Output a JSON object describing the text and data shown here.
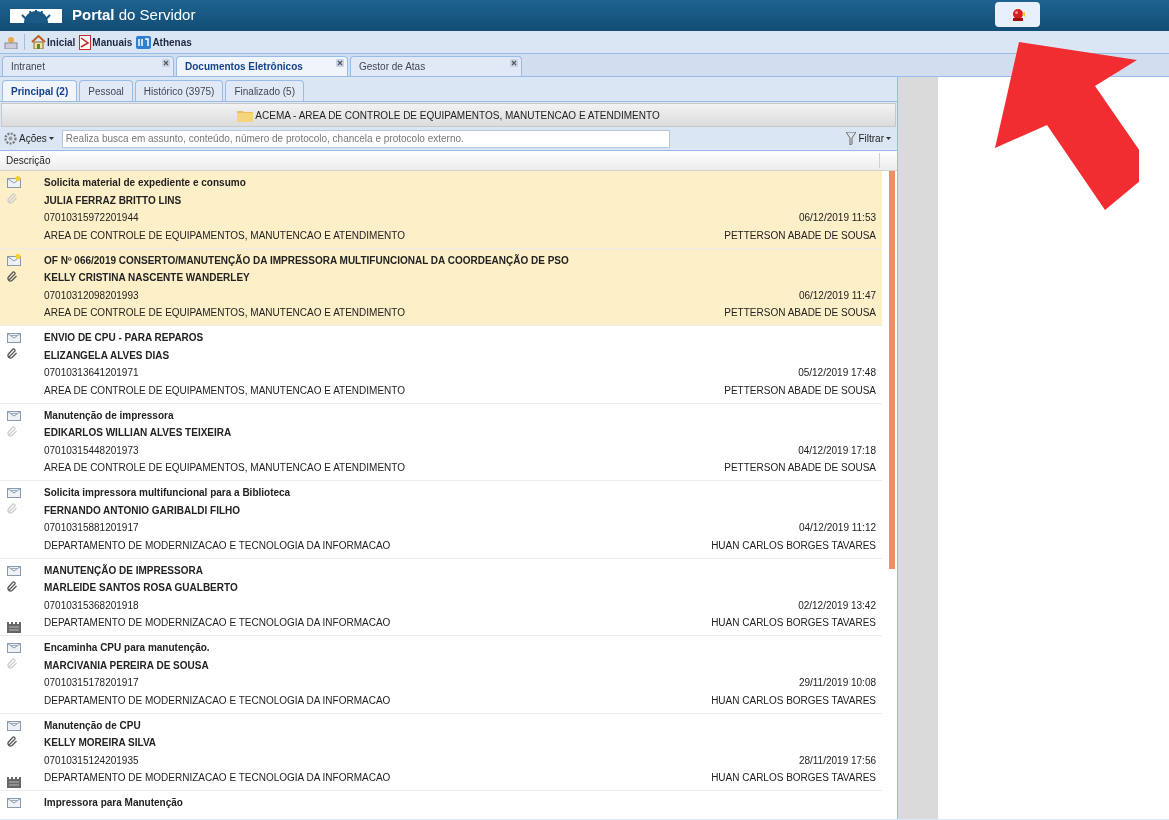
{
  "header": {
    "title": "**Portal** do Servidor"
  },
  "toolbar": [
    {
      "kind": "user"
    },
    {
      "kind": "home",
      "label": "Inicial"
    },
    {
      "kind": "pdf",
      "label": "Manuais"
    },
    {
      "kind": "app",
      "label": "Athenas"
    }
  ],
  "tabs": [
    {
      "label": "Intranet",
      "selected": false
    },
    {
      "label": "Documentos Eletrônicos",
      "selected": true
    },
    {
      "label": "Gestor de Atas",
      "selected": false
    }
  ],
  "subtabs": [
    {
      "label": "Principal (2)",
      "selected": true
    },
    {
      "label": "Pessoal",
      "selected": false
    },
    {
      "label": "Histórico (3975)",
      "selected": false
    },
    {
      "label": "Finalizado (5)",
      "selected": false
    }
  ],
  "folder": "ACEMA - AREA DE CONTROLE DE EQUIPAMENTOS, MANUTENCAO E ATENDIMENTO",
  "actions": "Ações",
  "search": {
    "placeholder": "Realiza busca em assunto, conteúdo, número de protocolo, chancela e protocolo externo."
  },
  "filter": "Filtrar",
  "column": "Descrição",
  "documents": [
    {
      "subject": "Solicita material de expediente e consumo",
      "sender": "JULIA FERRAZ BRITTO LINS",
      "protocol": "07010315972201944",
      "unit": "AREA DE CONTROLE DE EQUIPAMENTOS, MANUTENCAO E ATENDIMENTO",
      "date": "06/12/2019 11:53",
      "recipient": "PETTERSON ABADE DE SOUSA",
      "unread": true,
      "attachment": false,
      "external": false
    },
    {
      "subject": "OF Nº 066/2019 CONSERTO/MANUTENÇÃO DA IMPRESSORA MULTIFUNCIONAL DA COORDEANÇÃO DE PSO",
      "sender": "KELLY CRISTINA NASCENTE WANDERLEY",
      "protocol": "07010312098201993",
      "unit": "AREA DE CONTROLE DE EQUIPAMENTOS, MANUTENCAO E ATENDIMENTO",
      "date": "06/12/2019 11:47",
      "recipient": "PETTERSON ABADE DE SOUSA",
      "unread": true,
      "attachment": true,
      "external": false
    },
    {
      "subject": "ENVIO DE CPU - PARA REPAROS",
      "sender": "ELIZANGELA ALVES DIAS",
      "protocol": "07010313641201971",
      "unit": "AREA DE CONTROLE DE EQUIPAMENTOS, MANUTENCAO E ATENDIMENTO",
      "date": "05/12/2019 17:48",
      "recipient": "PETTERSON ABADE DE SOUSA",
      "unread": false,
      "attachment": true,
      "external": false
    },
    {
      "subject": "Manutenção de impressora",
      "sender": "EDIKARLOS WILLIAN ALVES TEIXEIRA",
      "protocol": "07010315448201973",
      "unit": "AREA DE CONTROLE DE EQUIPAMENTOS, MANUTENCAO E ATENDIMENTO",
      "date": "04/12/2019 17:18",
      "recipient": "PETTERSON ABADE DE SOUSA",
      "unread": false,
      "attachment": false,
      "external": false
    },
    {
      "subject": "Solicita impressora multifuncional para a Biblioteca",
      "sender": "FERNANDO ANTONIO GARIBALDI FILHO",
      "protocol": "07010315881201917",
      "unit": "DEPARTAMENTO DE MODERNIZACAO E TECNOLOGIA DA INFORMACAO",
      "date": "04/12/2019 11:12",
      "recipient": "HUAN CARLOS BORGES TAVARES",
      "unread": false,
      "attachment": false,
      "external": false
    },
    {
      "subject": "MANUTENÇÃO DE IMPRESSORA",
      "sender": "MARLEIDE SANTOS ROSA GUALBERTO",
      "protocol": "07010315368201918",
      "unit": "DEPARTAMENTO DE MODERNIZACAO E TECNOLOGIA DA INFORMACAO",
      "date": "02/12/2019 13:42",
      "recipient": "HUAN CARLOS BORGES TAVARES",
      "unread": false,
      "attachment": true,
      "external": true
    },
    {
      "subject": "Encaminha CPU para manutenção.",
      "sender": "MARCIVANIA PEREIRA DE SOUSA",
      "protocol": "07010315178201917",
      "unit": "DEPARTAMENTO DE MODERNIZACAO E TECNOLOGIA DA INFORMACAO",
      "date": "29/11/2019 10:08",
      "recipient": "HUAN CARLOS BORGES TAVARES",
      "unread": false,
      "attachment": false,
      "external": false
    },
    {
      "subject": "Manutenção de CPU",
      "sender": "KELLY MOREIRA SILVA",
      "protocol": "07010315124201935",
      "unit": "DEPARTAMENTO DE MODERNIZACAO E TECNOLOGIA DA INFORMACAO",
      "date": "28/11/2019 17:56",
      "recipient": "HUAN CARLOS BORGES TAVARES",
      "unread": false,
      "attachment": true,
      "external": true
    },
    {
      "subject": "Impressora para Manutenção",
      "unread": false
    }
  ]
}
